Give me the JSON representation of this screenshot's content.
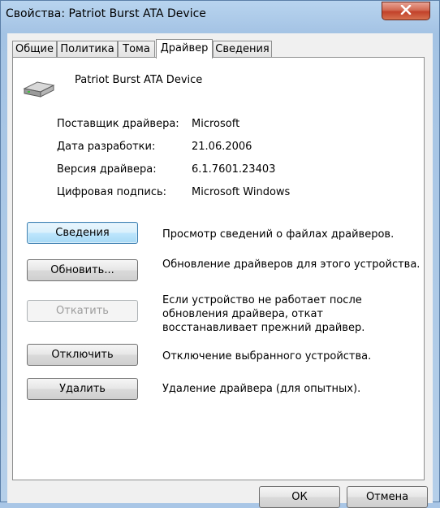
{
  "window": {
    "title": "Свойства: Patriot Burst ATA Device"
  },
  "tabs": [
    {
      "label": "Общие"
    },
    {
      "label": "Политика"
    },
    {
      "label": "Тома"
    },
    {
      "label": "Драйвер",
      "active": true
    },
    {
      "label": "Сведения"
    }
  ],
  "device": {
    "name": "Patriot Burst ATA Device",
    "icon": "hard-drive-icon"
  },
  "info": {
    "provider_label": "Поставщик драйвера:",
    "provider_value": "Microsoft",
    "date_label": "Дата разработки:",
    "date_value": "21.06.2006",
    "version_label": "Версия драйвера:",
    "version_value": "6.1.7601.23403",
    "signature_label": "Цифровая подпись:",
    "signature_value": "Microsoft Windows"
  },
  "actions": {
    "details_label": "Сведения",
    "details_desc": "Просмотр сведений о файлах драйверов.",
    "update_label": "Обновить...",
    "update_desc": "Обновление драйверов для этого устройства.",
    "rollback_label": "Откатить",
    "rollback_desc": "Если устройство не работает после обновления драйвера, откат восстанавливает прежний драйвер.",
    "disable_label": "Отключить",
    "disable_desc": "Отключение выбранного устройства.",
    "uninstall_label": "Удалить",
    "uninstall_desc": "Удаление драйвера (для опытных)."
  },
  "footer": {
    "ok_label": "ОК",
    "cancel_label": "Отмена"
  }
}
